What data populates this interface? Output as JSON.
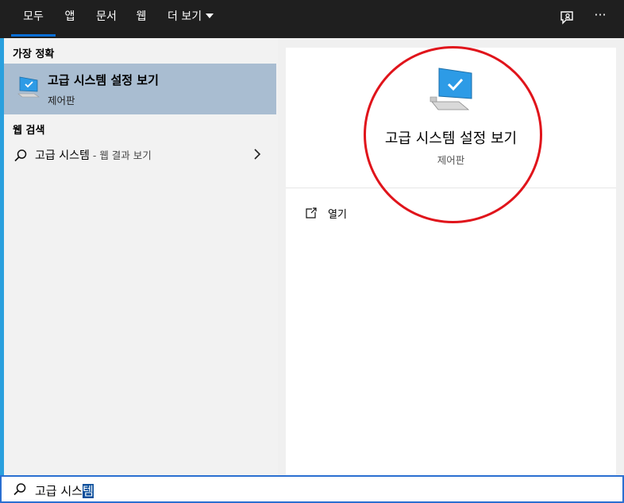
{
  "tabs": [
    {
      "label": "모두",
      "active": true
    },
    {
      "label": "앱"
    },
    {
      "label": "문서"
    },
    {
      "label": "웹"
    },
    {
      "label": "더 보기"
    }
  ],
  "top_icons": [
    "feedback-icon",
    "more-icon"
  ],
  "more_label": "···",
  "left": {
    "best_match_header": "가장 정확",
    "best_match": {
      "title": "고급 시스템 설정 보기",
      "subtitle": "제어판",
      "icon": "monitor-check-icon"
    },
    "web_search_header": "웹 검색",
    "web_item": {
      "main": "고급 시스템",
      "suffix": " - 웹 결과 보기"
    }
  },
  "preview": {
    "title": "고급 시스템 설정 보기",
    "subtitle": "제어판",
    "actions": [
      {
        "label": "열기",
        "icon": "open-icon"
      }
    ]
  },
  "search": {
    "typed": "고급 시스",
    "selected": "템"
  },
  "colors": {
    "accent": "#0a6fd6",
    "highlight": "#a9bdd1",
    "annotation": "#e0141b",
    "topbar": "#1f1f1f"
  }
}
